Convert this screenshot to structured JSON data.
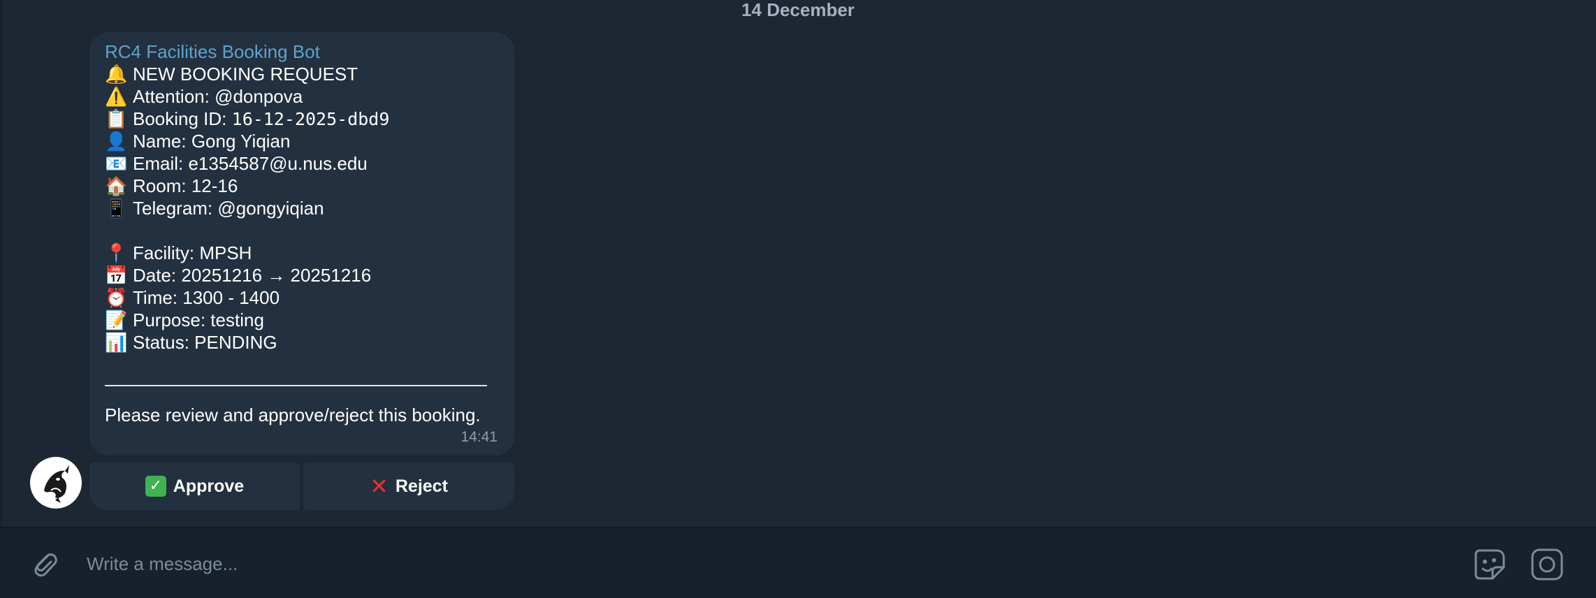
{
  "date_divider": "14 December",
  "message": {
    "sender": "RC4 Facilities Booking Bot",
    "lines": [
      {
        "icon": "🔔",
        "icon_name": "bell-icon",
        "text": "NEW BOOKING REQUEST"
      },
      {
        "icon": "⚠️",
        "icon_name": "warning-icon",
        "label": "Attention: ",
        "value": "@donpova"
      },
      {
        "icon": "📋",
        "icon_name": "clipboard-icon",
        "label": "Booking ID: ",
        "value": "16-12-2025-dbd9"
      },
      {
        "icon": "👤",
        "icon_name": "user-icon",
        "label": "Name: ",
        "value": "Gong Yiqian"
      },
      {
        "icon": "📧",
        "icon_name": "email-icon",
        "label": "Email: ",
        "value": "e1354587@u.nus.edu"
      },
      {
        "icon": "🏠",
        "icon_name": "house-icon",
        "label": "Room: ",
        "value": "12-16"
      },
      {
        "icon": "📱",
        "icon_name": "phone-icon",
        "label": "Telegram: ",
        "value": "@gongyiqian"
      },
      {
        "icon": "📍",
        "icon_name": "pin-icon",
        "label": "Facility: ",
        "value": "MPSH"
      },
      {
        "icon": "📅",
        "icon_name": "calendar-icon",
        "label": "Date: ",
        "value": "20251216 → 20251216"
      },
      {
        "icon": "⏰",
        "icon_name": "alarm-clock-icon",
        "label": "Time: ",
        "value": "1300 - 1400"
      },
      {
        "icon": "📝",
        "icon_name": "memo-icon",
        "label": "Purpose: ",
        "value": "testing"
      },
      {
        "icon": "📊",
        "icon_name": "bar-chart-icon",
        "label": "Status: ",
        "value": "PENDING"
      }
    ],
    "review_text": "Please review and approve/reject this booking.",
    "time": "14:41"
  },
  "buttons": {
    "approve_icon": "✓",
    "approve_label": "Approve",
    "reject_icon": "✕",
    "reject_label": "Reject"
  },
  "composer": {
    "placeholder": "Write a message..."
  },
  "colors": {
    "background": "#1c2733",
    "bubble": "#23303f",
    "sender": "#5fa3c9",
    "composer": "#17212b"
  }
}
